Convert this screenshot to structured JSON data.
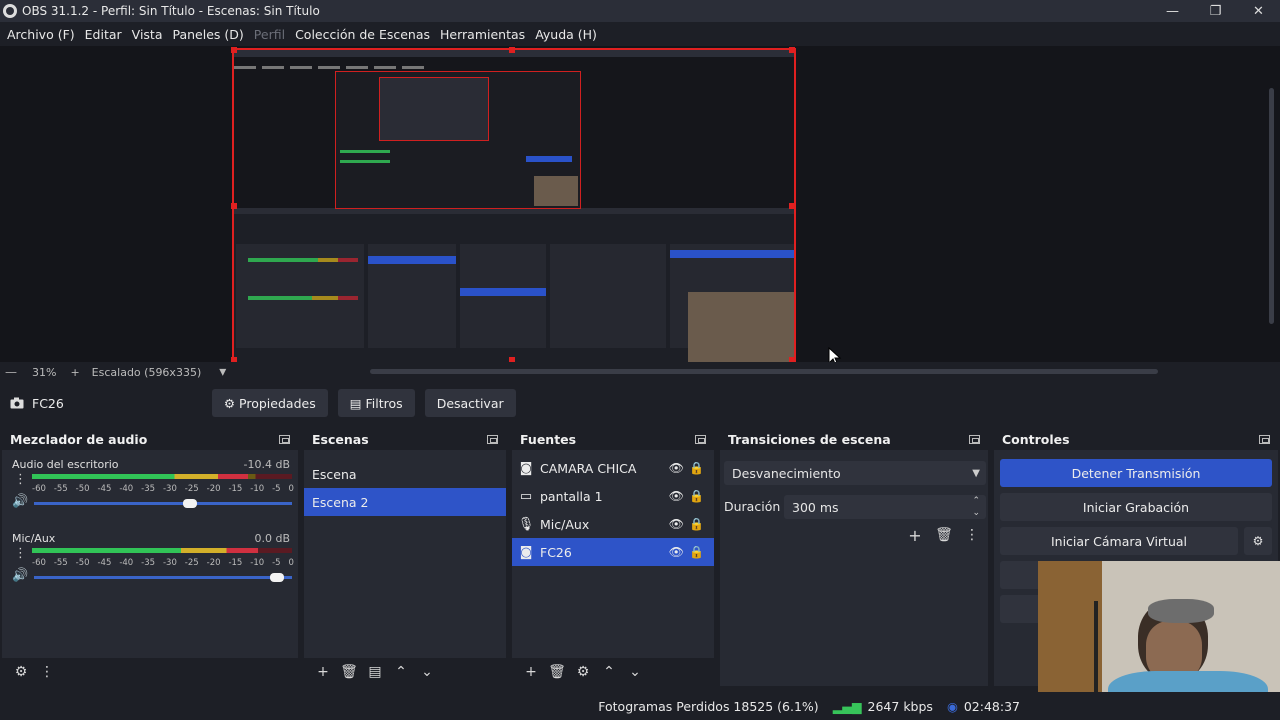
{
  "window": {
    "title": "OBS 31.1.2 - Perfil: Sin Título - Escenas: Sin Título",
    "minimize": "—",
    "maximize": "❐",
    "close": "✕"
  },
  "menu": [
    "Archivo (F)",
    "Editar",
    "Vista",
    "Paneles (D)",
    "Perfil",
    "Colección de Escenas",
    "Herramientas",
    "Ayuda (H)"
  ],
  "zoom": {
    "level": "31%",
    "add": "+",
    "scaling": "Escalado (596x335)",
    "dropdown": "▾"
  },
  "source_toolbar": {
    "source_name": "FC26",
    "properties": "Propiedades",
    "filters": "Filtros",
    "deactivate": "Desactivar"
  },
  "audio_mixer": {
    "title": "Mezclador de audio",
    "ticks": [
      "-60",
      "-55",
      "-50",
      "-45",
      "-40",
      "-35",
      "-30",
      "-25",
      "-20",
      "-15",
      "-10",
      "-5",
      "0"
    ],
    "channels": [
      {
        "name": "Audio del escritorio",
        "db": "-10.4 dB",
        "level": 0.83,
        "volume": 0.63
      },
      {
        "name": "Mic/Aux",
        "db": "0.0 dB",
        "level": 0.87,
        "volume": 0.97
      }
    ]
  },
  "scenes": {
    "title": "Escenas",
    "items": [
      "Escena",
      "Escena 2"
    ],
    "selected": 1
  },
  "sources": {
    "title": "Fuentes",
    "items": [
      {
        "name": "CAMARA CHICA",
        "icon": "camera-icon"
      },
      {
        "name": "pantalla 1",
        "icon": "monitor-icon"
      },
      {
        "name": "Mic/Aux",
        "icon": "microphone-icon"
      },
      {
        "name": "FC26",
        "icon": "camera-icon"
      }
    ],
    "selected": 3
  },
  "transitions": {
    "title": "Transiciones de escena",
    "selected": "Desvanecimiento",
    "duration_label": "Duración",
    "duration": "300 ms"
  },
  "controls": {
    "title": "Controles",
    "stop_stream": "Detener Transmisión",
    "start_recording": "Iniciar Grabación",
    "start_virtual_cam": "Iniciar Cámara Virtual",
    "accent": "#2e54c8"
  },
  "status": {
    "dropped_frames": "Fotogramas Perdidos 18525 (6.1%)",
    "bitrate": "2647 kbps",
    "live_time": "02:48:37"
  }
}
